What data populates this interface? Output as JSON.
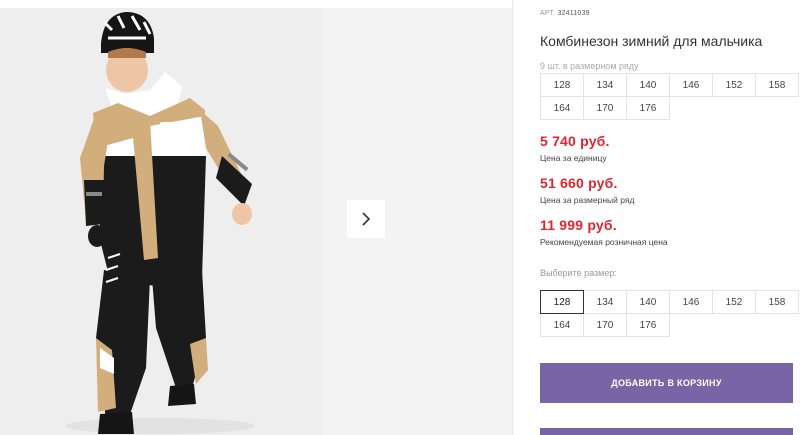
{
  "product": {
    "sku_label": "АРТ.",
    "sku": "32411039",
    "title": "Комбинезон зимний для мальчика",
    "pack_note": "9 шт. в размерном ряду",
    "pack_sizes": [
      "128",
      "134",
      "140",
      "146",
      "152",
      "158",
      "164",
      "170",
      "176"
    ]
  },
  "prices": [
    {
      "value": "5 740 руб.",
      "label": "Цена за единицу"
    },
    {
      "value": "51 660 руб.",
      "label": "Цена за размерный ряд"
    },
    {
      "value": "11 999 руб.",
      "label": "Рекомендуемая розничная цена"
    }
  ],
  "size_picker": {
    "label": "Выберите размер:",
    "sizes": [
      "128",
      "134",
      "140",
      "146",
      "152",
      "158",
      "164",
      "170",
      "176"
    ],
    "selected": "128"
  },
  "cart": {
    "add_label": "ДОБАВИТЬ В КОРЗИНУ"
  },
  "colors": {
    "price": "#e0252e",
    "button": "#7b64a6"
  },
  "icons": {
    "next": "chevron-right-icon"
  }
}
